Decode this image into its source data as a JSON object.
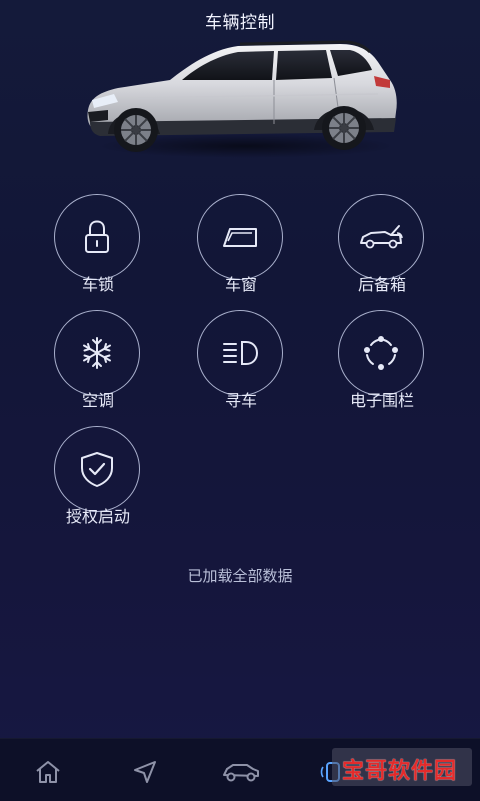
{
  "header": {
    "title": "车辆控制"
  },
  "controls": [
    {
      "label": "车锁",
      "icon": "lock-icon"
    },
    {
      "label": "车窗",
      "icon": "window-icon"
    },
    {
      "label": "后备箱",
      "icon": "trunk-icon"
    },
    {
      "label": "空调",
      "icon": "snowflake-icon"
    },
    {
      "label": "寻车",
      "icon": "headlight-icon"
    },
    {
      "label": "电子围栏",
      "icon": "geofence-icon"
    },
    {
      "label": "授权启动",
      "icon": "shield-check-icon"
    }
  ],
  "status": {
    "text": "已加载全部数据"
  },
  "bottom_nav": {
    "items": [
      {
        "icon": "home-icon"
      },
      {
        "icon": "navigation-icon"
      },
      {
        "icon": "car-icon"
      },
      {
        "icon": "remote-icon"
      }
    ]
  },
  "watermark": {
    "text": "宝哥软件园"
  },
  "colors": {
    "background_top": "#141a3a",
    "background_bottom": "#171843",
    "ring": "#dce4ff",
    "label": "#e6e9f7",
    "status": "#b9bfd8",
    "nav_bar": "#0d1028",
    "watermark_text": "#e32b2b"
  }
}
